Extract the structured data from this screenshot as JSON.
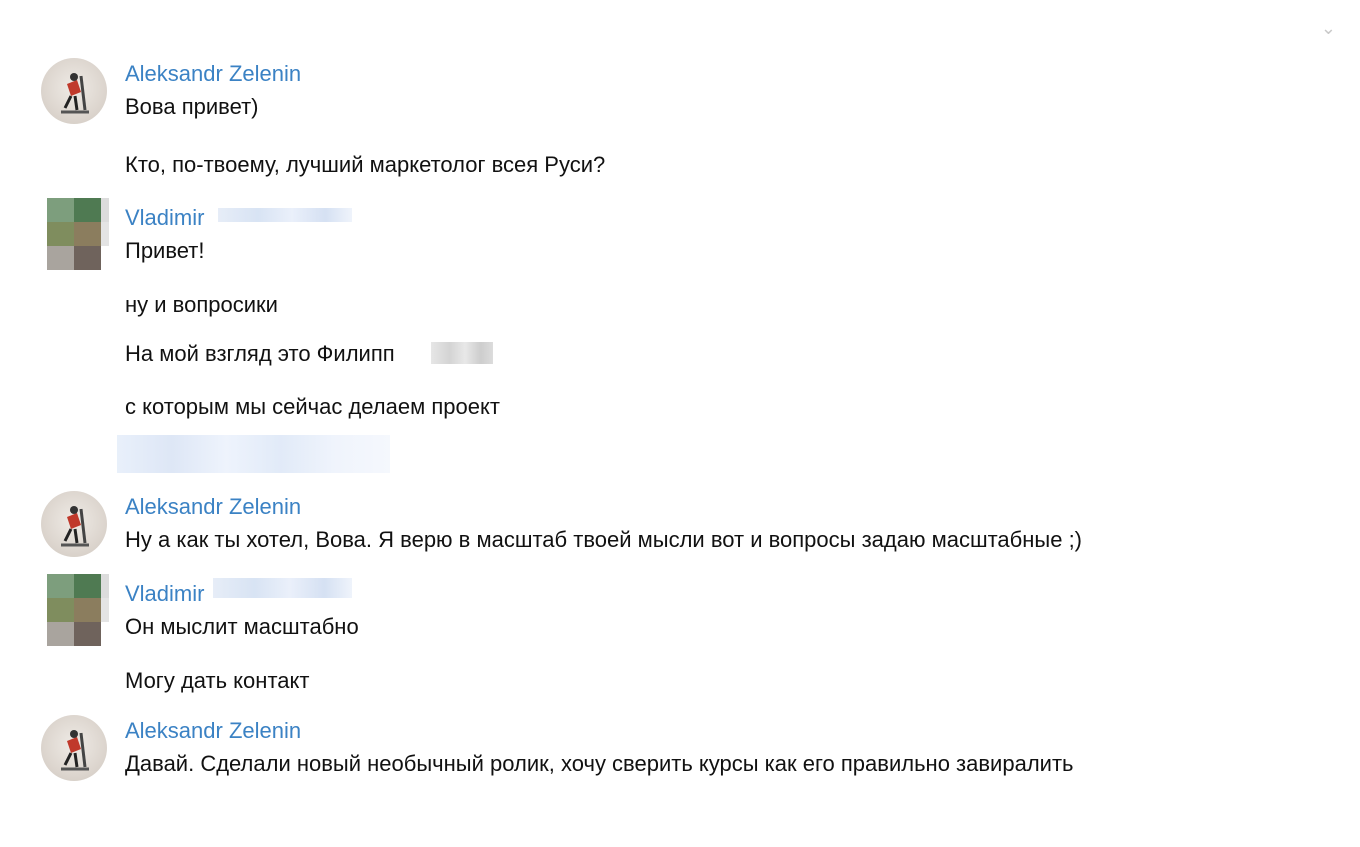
{
  "messages": [
    {
      "sender": "Aleksandr Zelenin",
      "lines": [
        "Вова привет)",
        "Кто, по-твоему, лучший маркетолог всея Руси?"
      ]
    },
    {
      "sender": "Vladimir",
      "lines": [
        "Привет!",
        "ну и вопросики",
        "На мой взгляд это Филипп",
        "с которым мы сейчас делаем проект"
      ]
    },
    {
      "sender": "Aleksandr Zelenin",
      "lines": [
        "Ну а как ты хотел, Вова. Я верю в масштаб твоей мысли вот и вопросы задаю масштабные ;)"
      ]
    },
    {
      "sender": "Vladimir",
      "lines": [
        "Он мыслит масштабно",
        "Могу дать контакт"
      ]
    },
    {
      "sender": "Aleksandr Zelenin",
      "lines": [
        "Давай. Сделали новый необычный ролик, хочу сверить курсы как его правильно завиралить"
      ]
    }
  ],
  "colors": {
    "sender": "#3b82c4",
    "text": "#111111",
    "background": "#ffffff"
  },
  "icons": {
    "aleksandr_avatar": "avatar-person-on-exercise-machine",
    "vladimir_avatar": "avatar-pixelated"
  }
}
